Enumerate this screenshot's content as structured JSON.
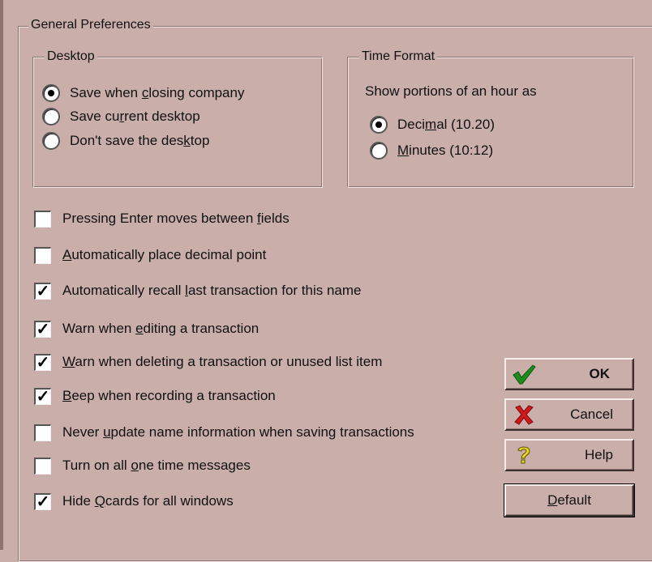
{
  "general": {
    "title": "General Preferences"
  },
  "desktop": {
    "title": "Desktop",
    "options": [
      {
        "pre": "Save when ",
        "key": "c",
        "post": "losing company",
        "selected": true
      },
      {
        "pre": "Save cu",
        "key": "r",
        "post": "rent desktop",
        "selected": false
      },
      {
        "pre": "Don't save the des",
        "key": "k",
        "post": "top",
        "selected": false
      }
    ]
  },
  "time_format": {
    "title": "Time Format",
    "caption": "Show portions of an hour as",
    "options": [
      {
        "pre": "Deci",
        "key": "m",
        "post": "al (10.20)",
        "selected": true
      },
      {
        "pre": "",
        "key": "M",
        "post": "inutes (10:12)",
        "selected": false
      }
    ]
  },
  "checkboxes": [
    {
      "pre": "Pressing Enter moves between ",
      "key": "f",
      "post": "ields",
      "checked": false
    },
    {
      "pre": "",
      "key": "A",
      "post": "utomatically place decimal point",
      "checked": false
    },
    {
      "pre": "Automatically recall ",
      "key": "l",
      "post": "ast transaction for this name",
      "checked": true
    },
    {
      "pre": "Warn when ",
      "key": "e",
      "post": "diting a transaction",
      "checked": true
    },
    {
      "pre": "",
      "key": "W",
      "post": "arn when deleting a transaction or unused list item",
      "checked": true
    },
    {
      "pre": "",
      "key": "B",
      "post": "eep when recording a transaction",
      "checked": true
    },
    {
      "pre": "Never ",
      "key": "u",
      "post": "pdate name information when saving transactions",
      "checked": false
    },
    {
      "pre": "Turn on all ",
      "key": "o",
      "post": "ne time messages",
      "checked": false
    },
    {
      "pre": "Hide ",
      "key": "Q",
      "post": "cards for all windows",
      "checked": true
    }
  ],
  "buttons": {
    "ok": "OK",
    "cancel": "Cancel",
    "help": "Help",
    "default_pre": "",
    "default_key": "D",
    "default_post": "efault"
  },
  "icons": {
    "ok": "checkmark-icon",
    "cancel": "red-x-icon",
    "help": "question-mark-icon"
  },
  "colors": {
    "background": "#c9aeaa",
    "ok_green": "#1c8a1c",
    "cancel_red": "#d01818",
    "help_yellow": "#e8d820"
  }
}
